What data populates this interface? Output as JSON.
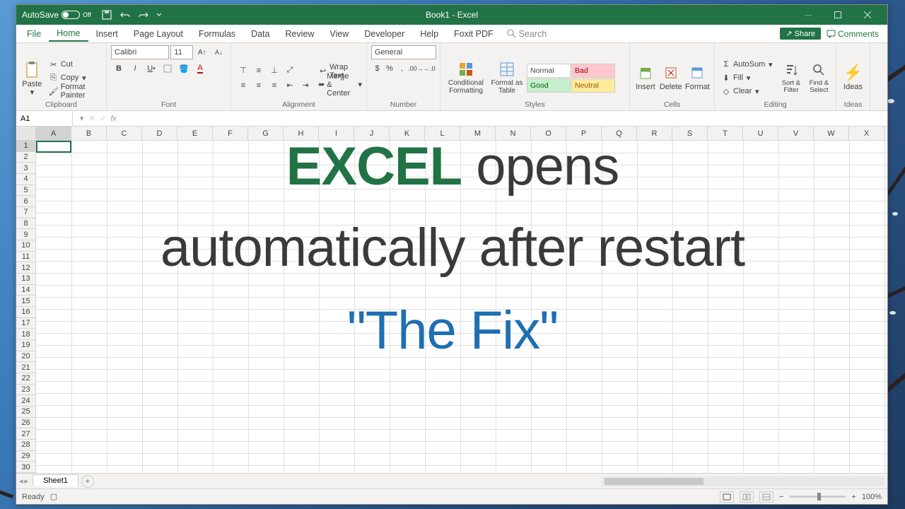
{
  "titlebar": {
    "autosave": "AutoSave",
    "autosave_state": "Off",
    "title": "Book1 - Excel"
  },
  "menus": {
    "file": "File",
    "home": "Home",
    "insert": "Insert",
    "page_layout": "Page Layout",
    "formulas": "Formulas",
    "data": "Data",
    "review": "Review",
    "view": "View",
    "developer": "Developer",
    "help": "Help",
    "foxit": "Foxit PDF",
    "search": "Search",
    "share": "Share",
    "comments": "Comments"
  },
  "ribbon": {
    "clipboard": {
      "label": "Clipboard",
      "paste": "Paste",
      "cut": "Cut",
      "copy": "Copy",
      "painter": "Format Painter"
    },
    "font": {
      "label": "Font",
      "name": "Calibri",
      "size": "11"
    },
    "alignment": {
      "label": "Alignment",
      "wrap": "Wrap Text",
      "merge": "Merge & Center"
    },
    "number": {
      "label": "Number",
      "format": "General"
    },
    "styles": {
      "label": "Styles",
      "cond": "Conditional Formatting",
      "table": "Format as Table",
      "normal": "Normal",
      "bad": "Bad",
      "good": "Good",
      "neutral": "Neutral"
    },
    "cells": {
      "label": "Cells",
      "insert": "Insert",
      "delete": "Delete",
      "format": "Format"
    },
    "editing": {
      "label": "Editing",
      "autosum": "AutoSum",
      "fill": "Fill",
      "clear": "Clear",
      "sort": "Sort & Filter",
      "find": "Find & Select"
    },
    "ideas": {
      "label": "Ideas",
      "btn": "Ideas"
    }
  },
  "fbar": {
    "cell": "A1"
  },
  "columns": [
    "A",
    "B",
    "C",
    "D",
    "E",
    "F",
    "G",
    "H",
    "I",
    "J",
    "K",
    "L",
    "M",
    "N",
    "O",
    "P",
    "Q",
    "R",
    "S",
    "T",
    "U",
    "V",
    "W",
    "X"
  ],
  "rows": [
    "1",
    "2",
    "3",
    "4",
    "5",
    "6",
    "7",
    "8",
    "9",
    "10",
    "11",
    "12",
    "13",
    "14",
    "15",
    "16",
    "17",
    "18",
    "19",
    "20",
    "21",
    "22",
    "23",
    "24",
    "25",
    "26",
    "27",
    "28",
    "29",
    "30"
  ],
  "sheet": {
    "name": "Sheet1"
  },
  "status": {
    "ready": "Ready",
    "zoom": "100%"
  },
  "overlay": {
    "excel": "EXCEL",
    "opens": " opens",
    "line2": "automatically after restart",
    "line3": "\"The Fix\""
  }
}
